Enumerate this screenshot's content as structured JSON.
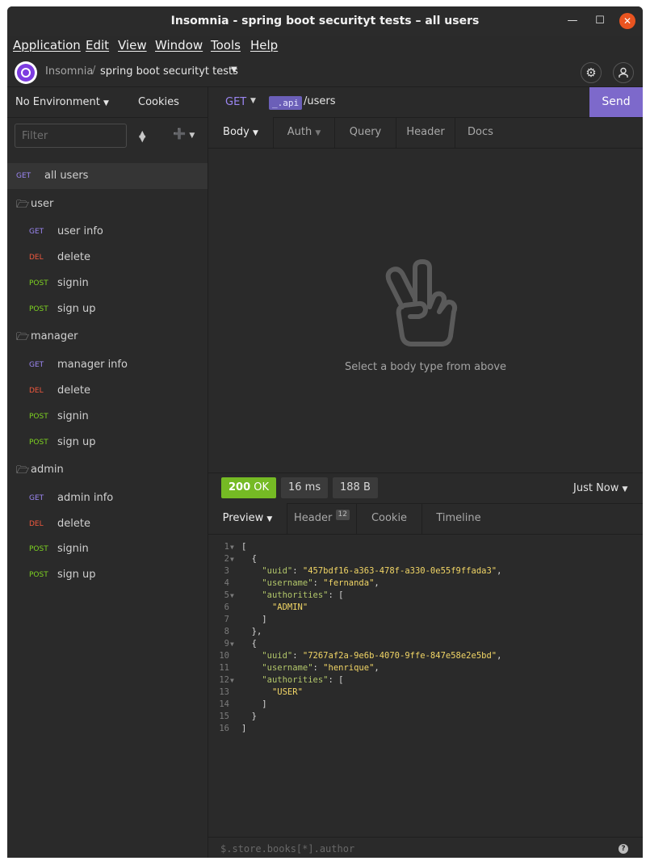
{
  "window": {
    "title": "Insomnia - spring boot securityt tests – all users"
  },
  "menu": [
    "Application",
    "Edit",
    "View",
    "Window",
    "Tools",
    "Help"
  ],
  "header": {
    "app": "Insomnia",
    "separator": "/",
    "workspace": "spring boot securityt tests"
  },
  "sidebar": {
    "environment": "No Environment",
    "cookies": "Cookies",
    "filter_placeholder": "Filter",
    "items": [
      {
        "method": "GET",
        "name": "all users"
      },
      {
        "folder": "user"
      },
      {
        "method": "GET",
        "name": "user info"
      },
      {
        "method": "DEL",
        "name": "delete"
      },
      {
        "method": "POST",
        "name": "signin"
      },
      {
        "method": "POST",
        "name": "sign up"
      },
      {
        "folder": "manager"
      },
      {
        "method": "GET",
        "name": "manager info"
      },
      {
        "method": "DEL",
        "name": "delete"
      },
      {
        "method": "POST",
        "name": "signin"
      },
      {
        "method": "POST",
        "name": "sign up"
      },
      {
        "folder": "admin"
      },
      {
        "method": "GET",
        "name": "admin info"
      },
      {
        "method": "DEL",
        "name": "delete"
      },
      {
        "method": "POST",
        "name": "signin"
      },
      {
        "method": "POST",
        "name": "sign up"
      }
    ]
  },
  "request": {
    "method": "GET",
    "url_tag": "_.api",
    "url_path": "/users",
    "send": "Send",
    "tabs": [
      "Body",
      "Auth",
      "Query",
      "Header",
      "Docs"
    ],
    "empty_message": "Select a body type from above"
  },
  "response": {
    "status_code": "200",
    "status_text": "OK",
    "time": "16 ms",
    "size": "188 B",
    "when": "Just Now",
    "tabs": [
      "Preview",
      "Header",
      "Cookie",
      "Timeline"
    ],
    "header_count": "12",
    "filter_placeholder": "$.store.books[*].author",
    "help": "?",
    "users": [
      {
        "uuid": "457bdf16-a363-478f-a330-0e55f9ffada3",
        "username": "fernanda",
        "authorities": [
          "ADMIN"
        ]
      },
      {
        "uuid": "7267af2a-9e6b-4070-9ffe-847e58e2e5bd",
        "username": "henrique",
        "authorities": [
          "USER"
        ]
      }
    ]
  },
  "colors": {
    "accent": "#7d69cb",
    "get": "#9b86f2",
    "delete": "#f0583e",
    "post": "#7ed321",
    "ok": "#75ba24",
    "close": "#e95420"
  },
  "icons": {
    "settings": "gear-icon",
    "account": "user-icon",
    "folder": "folder-icon",
    "empty": "peace-hand-icon"
  }
}
